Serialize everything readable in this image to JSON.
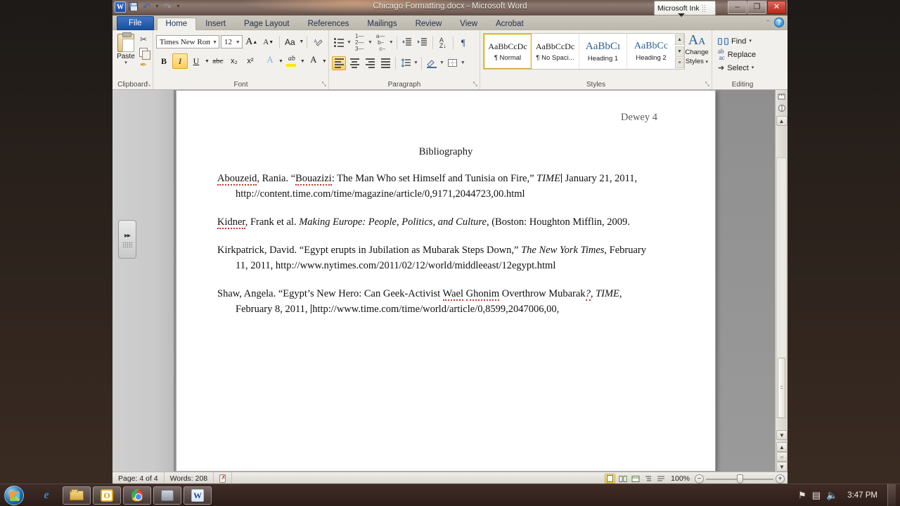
{
  "window": {
    "title": "Chicago Formatting.docx - Microsoft Word",
    "app_icon": "word-icon",
    "quick_access": [
      {
        "name": "save-icon",
        "label": "Save"
      },
      {
        "name": "undo-icon",
        "label": "Undo"
      },
      {
        "name": "redo-icon",
        "label": "Redo"
      },
      {
        "name": "customize-qat-icon",
        "label": "Customize Quick Access Toolbar"
      }
    ],
    "controls": {
      "minimize": "–",
      "maximize": "❐",
      "close": "✕"
    }
  },
  "ink_toolbar": {
    "label": "Microsoft Ink",
    "grip": "grip-dots-icon"
  },
  "ribbon": {
    "tabs": [
      {
        "label": "File",
        "state": "file"
      },
      {
        "label": "Home",
        "state": "active"
      },
      {
        "label": "Insert",
        "state": ""
      },
      {
        "label": "Page Layout",
        "state": ""
      },
      {
        "label": "References",
        "state": ""
      },
      {
        "label": "Mailings",
        "state": ""
      },
      {
        "label": "Review",
        "state": ""
      },
      {
        "label": "View",
        "state": ""
      },
      {
        "label": "Acrobat",
        "state": ""
      }
    ],
    "collapse_label": "⌃",
    "help_label": "?",
    "clipboard": {
      "group_label": "Clipboard",
      "paste_label": "Paste",
      "paste_caret": "▾",
      "cut_label": "Cut",
      "copy_label": "Copy",
      "format_painter_label": "Format Painter",
      "dialog_launcher": "⤡"
    },
    "font": {
      "group_label": "Font",
      "font_name": "Times New Rom",
      "font_size": "12",
      "grow_label": "A",
      "shrink_label": "A",
      "change_case_label": "Aa",
      "clear_formatting_label": "clear-formatting-icon",
      "bold_label": "B",
      "italic_label": "I",
      "underline_label": "U",
      "strikethrough_label": "abc",
      "subscript_label": "x₂",
      "superscript_label": "x²",
      "text_effects_label": "A",
      "highlight_label": "ab",
      "font_color_label": "A",
      "dialog_launcher": "⤡",
      "active_buttons": [
        "italic"
      ]
    },
    "paragraph": {
      "group_label": "Paragraph",
      "bullets_label": "Bullets",
      "numbering_label": "Numbering",
      "multilevel_label": "Multilevel List",
      "decrease_indent_label": "Decrease Indent",
      "increase_indent_label": "Increase Indent",
      "sort_label": "A↓",
      "show_marks_label": "¶",
      "align_left_label": "Align Left",
      "center_label": "Center",
      "align_right_label": "Align Right",
      "justify_label": "Justify",
      "line_spacing_label": "Line Spacing",
      "shading_label": "Shading",
      "borders_label": "Borders",
      "dialog_launcher": "⤡",
      "active_buttons": [
        "align-left"
      ]
    },
    "styles": {
      "group_label": "Styles",
      "items": [
        {
          "preview": "AaBbCcDc",
          "name": "¶ Normal",
          "selected": true
        },
        {
          "preview": "AaBbCcDc",
          "name": "¶ No Spaci...",
          "selected": false
        },
        {
          "preview": "AaBbCı",
          "name": "Heading 1",
          "selected": false
        },
        {
          "preview": "AaBbCc",
          "name": "Heading 2",
          "selected": false
        }
      ],
      "nav": {
        "up": "▲",
        "down": "▼",
        "more": "≡"
      },
      "change_styles_label": "Change",
      "change_styles_label2": "Styles",
      "change_styles_caret": "▾",
      "dialog_launcher": "⤡"
    },
    "editing": {
      "group_label": "Editing",
      "find_label": "Find",
      "find_caret": "▾",
      "replace_label": "Replace",
      "select_label": "Select",
      "select_caret": "▾"
    }
  },
  "navigation_pane": {
    "expand_label": "▸▸",
    "grip": "grip-icon"
  },
  "document": {
    "header": "Dewey 4",
    "title": "Bibliography",
    "entries": [
      {
        "parts": [
          {
            "t": "Abouzeid",
            "s": "sq"
          },
          {
            "t": ", Rania.  “",
            "s": ""
          },
          {
            "t": "Bouazizi",
            "s": "sq"
          },
          {
            "t": ":  The Man Who set Himself and Tunisia on Fire,” ",
            "s": ""
          },
          {
            "t": "TIME",
            "s": "it"
          },
          {
            "t": "|",
            "s": "caret"
          },
          {
            "t": " January 21, 2011, http://content.time.com/time/magazine/article/0,9171,2044723,00.html",
            "s": ""
          }
        ]
      },
      {
        "parts": [
          {
            "t": "Kidner",
            "s": "sq"
          },
          {
            "t": ", Frank et al. ",
            "s": ""
          },
          {
            "t": "Making Europe: People, Politics, and Culture",
            "s": "it"
          },
          {
            "t": ", (Boston: Houghton Mifflin, 2009.",
            "s": ""
          }
        ]
      },
      {
        "parts": [
          {
            "t": "Kirkpatrick, David. “Egypt erupts in Jubilation as Mubarak Steps Down,” ",
            "s": ""
          },
          {
            "t": "The New York Times",
            "s": "it"
          },
          {
            "t": ", February 11, 2011, http://www.nytimes.com/2011/02/12/world/middleeast/12egypt.html",
            "s": ""
          }
        ]
      },
      {
        "parts": [
          {
            "t": "Shaw, Angela. “Egypt’s New Hero:  Can Geek-Activist ",
            "s": ""
          },
          {
            "t": "Wael",
            "s": "sq"
          },
          {
            "t": " ",
            "s": ""
          },
          {
            "t": "Ghonim",
            "s": "sq"
          },
          {
            "t": " Overthrow Mubarak",
            "s": ""
          },
          {
            "t": "?",
            "s": "it-sq"
          },
          {
            "t": ", ",
            "s": ""
          },
          {
            "t": "TIME",
            "s": "it"
          },
          {
            "t": ", February 8, 2011, ",
            "s": ""
          },
          {
            "t": "|",
            "s": "caret"
          },
          {
            "t": "http://www.time.com/time/world/article/0,8599,2047006,00,",
            "s": ""
          }
        ]
      }
    ]
  },
  "scrollbar": {
    "ruler_icon": "view-ruler-icon",
    "split_icon": "split-window-icon",
    "scroll_up": "▲",
    "scroll_down": "▼",
    "previous_page": "⬆",
    "browse_object": "○",
    "next_page": "⬇"
  },
  "status_bar": {
    "page": "Page: 4 of 4",
    "words": "Words: 208",
    "proofing_icon": "proofing-errors-icon",
    "views": [
      {
        "name": "print-layout-view",
        "active": true
      },
      {
        "name": "full-screen-reading-view",
        "active": false
      },
      {
        "name": "web-layout-view",
        "active": false
      },
      {
        "name": "outline-view",
        "active": false
      },
      {
        "name": "draft-view",
        "active": false
      }
    ],
    "zoom": "100%",
    "zoom_out": "−",
    "zoom_in": "+"
  },
  "taskbar": {
    "start_label": "start-orb-icon",
    "items": [
      {
        "name": "internet-explorer",
        "icon": "ie-icon",
        "pressed": false
      },
      {
        "name": "windows-explorer",
        "icon": "folder-icon",
        "pressed": true
      },
      {
        "name": "outlook",
        "icon": "outlook-icon",
        "pressed": true
      },
      {
        "name": "google-chrome",
        "icon": "chrome-icon",
        "pressed": true
      },
      {
        "name": "generic-app",
        "icon": "app-icon",
        "pressed": true
      },
      {
        "name": "microsoft-word",
        "icon": "word-icon",
        "pressed": true
      }
    ],
    "tray": [
      {
        "name": "action-center-flag-icon",
        "glyph": "⚑"
      },
      {
        "name": "network-icon",
        "glyph": "▤"
      },
      {
        "name": "volume-icon",
        "glyph": "🔊"
      }
    ],
    "clock": "3:47 PM",
    "show_desktop": "show-desktop-button"
  }
}
